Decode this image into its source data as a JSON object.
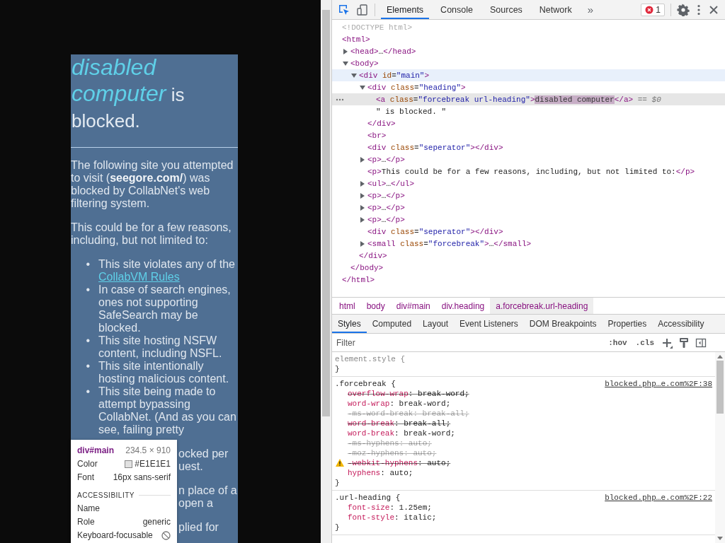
{
  "page": {
    "heading_link": "disabled computer",
    "heading_rest": [
      "is",
      "blocked."
    ],
    "paragraphs": [
      "The following site you attempted to visit (**seegore.com/**) was blocked by CollabNet's web filtering system.",
      "This could be for a few reasons, including, but not limited to:"
    ],
    "reasons": [
      {
        "marker": "•",
        "text": "This site violates any of the",
        "link": "CollabVM Rules"
      },
      {
        "marker": "•",
        "text": "In case of search engines, ones not supporting SafeSearch may be blocked."
      },
      {
        "marker": "•",
        "text": "This site hosting NSFW content, including NSFL."
      },
      {
        "marker": "•",
        "text": "This site intentionally hosting malicious content."
      },
      {
        "marker": "•",
        "text": "This site being made to attempt bypassing CollabNet. (And as you can see, failing pretty"
      }
    ],
    "covered_fragments": [
      [
        "ocked per",
        "uest."
      ],
      [
        "n place of a",
        "open a"
      ],
      [
        "plied for"
      ]
    ]
  },
  "inspect_tooltip": {
    "element": "div#main",
    "size": "234.5 × 910",
    "rows": [
      {
        "label": "Color",
        "value": "#E1E1E1",
        "color": "#e1e1e1"
      },
      {
        "label": "Font",
        "value": "16px sans-serif"
      }
    ],
    "section": "ACCESSIBILITY",
    "a11y": [
      {
        "label": "Name"
      },
      {
        "label": "Role",
        "value": "generic"
      },
      {
        "label": "Keyboard-focusable",
        "kind": "not-allowed"
      }
    ]
  },
  "devtools": {
    "tabs": [
      {
        "label": "Elements",
        "selected": true
      },
      {
        "label": "Console",
        "selected": false
      },
      {
        "label": "Sources",
        "selected": false
      },
      {
        "label": "Network",
        "selected": false
      }
    ],
    "more_tabs": "»",
    "error_count": "1",
    "dom_tree": [
      {
        "kind": "doctype",
        "markup": "<!DOCTYPE html>",
        "selected": false,
        "hovered": false
      },
      {
        "kind": "root",
        "markup": "<html>",
        "selected": false,
        "hovered": false,
        "close": "</html>",
        "children": [
          {
            "kind": "node",
            "markup": "<head>…</head>",
            "expanded": false,
            "selected": false,
            "hovered": false
          },
          {
            "kind": "node",
            "markup": "<body>",
            "expanded": true,
            "selected": false,
            "hovered": false,
            "close": "</body>",
            "children": [
              {
                "kind": "node",
                "markup": "<div id=\"main\">",
                "expanded": true,
                "selected": false,
                "hovered": true,
                "close": "</div>",
                "children": [
                  {
                    "kind": "node",
                    "markup": "<div class=\"heading\">",
                    "expanded": true,
                    "selected": false,
                    "hovered": false,
                    "close": "</div>",
                    "children": [
                      {
                        "kind": "leaf",
                        "markup": "<a class=\"forcebreak url-heading\">",
                        "content": "disabled computer",
                        "markup_after": "</a>",
                        "note": "== $0",
                        "selected": true,
                        "hovered": false
                      },
                      {
                        "kind": "text",
                        "markup": "\" is blocked. \"",
                        "selected": false,
                        "hovered": false
                      }
                    ]
                  },
                  {
                    "kind": "leaf",
                    "markup": "<br>",
                    "selected": false,
                    "hovered": false
                  },
                  {
                    "kind": "leaf",
                    "markup": "<div class=\"seperator\"></div>",
                    "selected": false,
                    "hovered": false
                  },
                  {
                    "kind": "node",
                    "markup": "<p>…</p>",
                    "expanded": false,
                    "selected": false,
                    "hovered": false
                  },
                  {
                    "kind": "leaf",
                    "markup": "<p>This could be for a few reasons, including, but not limited to:</p>",
                    "selected": false,
                    "hovered": false
                  },
                  {
                    "kind": "node",
                    "markup": "<ul>…</ul>",
                    "expanded": false,
                    "selected": false,
                    "hovered": false
                  },
                  {
                    "kind": "node",
                    "markup": "<p>…</p>",
                    "expanded": false,
                    "selected": false,
                    "hovered": false
                  },
                  {
                    "kind": "node",
                    "markup": "<p>…</p>",
                    "expanded": false,
                    "selected": false,
                    "hovered": false
                  },
                  {
                    "kind": "node",
                    "markup": "<p>…</p>",
                    "expanded": false,
                    "selected": false,
                    "hovered": false
                  },
                  {
                    "kind": "leaf",
                    "markup": "<div class=\"seperator\"></div>",
                    "selected": false,
                    "hovered": false
                  },
                  {
                    "kind": "node",
                    "markup": "<small class=\"forcebreak\">…</small>",
                    "expanded": false,
                    "selected": false,
                    "hovered": false
                  }
                ]
              }
            ]
          }
        ]
      }
    ],
    "breadcrumbs": [
      {
        "label": "html",
        "selected": false
      },
      {
        "label": "body",
        "selected": false
      },
      {
        "label": "div#main",
        "selected": false
      },
      {
        "label": "div.heading",
        "selected": false
      },
      {
        "label": "a.forcebreak.url-heading",
        "selected": true
      }
    ],
    "side_tabs": [
      {
        "label": "Styles",
        "selected": true
      },
      {
        "label": "Computed",
        "selected": false
      },
      {
        "label": "Layout",
        "selected": false
      },
      {
        "label": "Event Listeners",
        "selected": false
      },
      {
        "label": "DOM Breakpoints",
        "selected": false
      },
      {
        "label": "Properties",
        "selected": false
      },
      {
        "label": "Accessibility",
        "selected": false
      }
    ],
    "filter": {
      "placeholder": "Filter"
    },
    "hov": ":hov",
    "cls": ".cls",
    "rules": [
      {
        "kind": "inline",
        "selector": "element.style {",
        "close": "}"
      },
      {
        "kind": "rule",
        "selector": ".forcebreak {",
        "source": "blocked.php…e.com%2F:38",
        "close": "}",
        "props": [
          {
            "text": "overflow-wrap: break-word;",
            "overridden": true,
            "invalid": false,
            "warning": false
          },
          {
            "text": "word-wrap: break-word;",
            "overridden": false,
            "invalid": false,
            "warning": false
          },
          {
            "text": "-ms-word-break: break-all;",
            "overridden": true,
            "invalid": true,
            "warning": false
          },
          {
            "text": "word-break: break-all;",
            "overridden": true,
            "invalid": false,
            "warning": false
          },
          {
            "text": "word-break: break-word;",
            "overridden": false,
            "invalid": false,
            "warning": false
          },
          {
            "text": "-ms-hyphens: auto;",
            "overridden": true,
            "invalid": true,
            "warning": false
          },
          {
            "text": "-moz-hyphens: auto;",
            "overridden": true,
            "invalid": true,
            "warning": false
          },
          {
            "text": "-webkit-hyphens: auto;",
            "overridden": true,
            "invalid": false,
            "warning": true
          },
          {
            "text": "hyphens: auto;",
            "overridden": false,
            "invalid": false,
            "warning": false
          }
        ]
      },
      {
        "kind": "rule",
        "selector": ".url-heading {",
        "source": "blocked.php…e.com%2F:22",
        "close": "}",
        "props": [
          {
            "text": "font-size: 1.25em;",
            "overridden": false,
            "invalid": false,
            "warning": false
          },
          {
            "text": "font-style: italic;",
            "overridden": false,
            "invalid": false,
            "warning": false
          }
        ]
      }
    ]
  }
}
